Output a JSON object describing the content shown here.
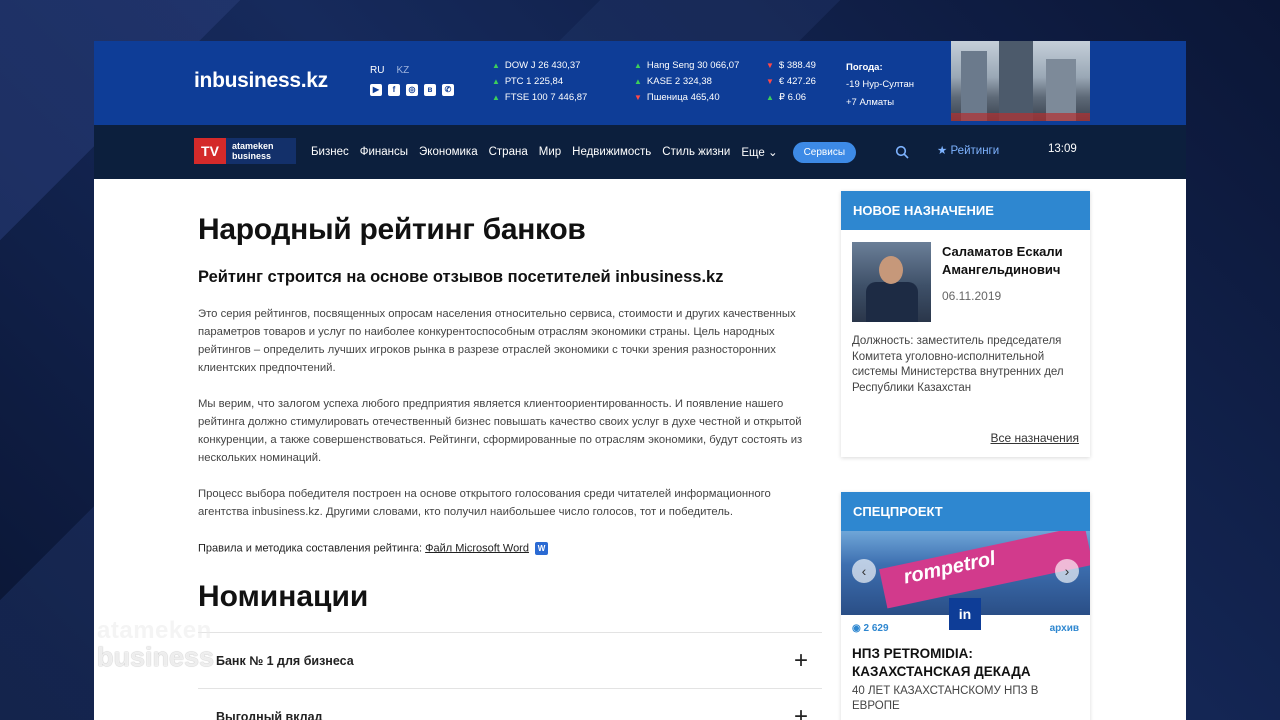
{
  "site": {
    "logo_in": "in",
    "logo_rest": "business.kz"
  },
  "langs": {
    "ru": "RU",
    "kz": "KZ"
  },
  "socials": [
    "youtube-icon",
    "facebook-icon",
    "instagram-icon",
    "vk-icon",
    "whatsapp-icon"
  ],
  "tickers": {
    "col1": [
      {
        "dir": "up",
        "text": "DOW J 26 430,37"
      },
      {
        "dir": "up",
        "text": "РТС 1 225,84"
      },
      {
        "dir": "up",
        "text": "FTSE 100 7 446,87"
      }
    ],
    "col2": [
      {
        "dir": "up",
        "text": "Hang Seng 30 066,07"
      },
      {
        "dir": "up",
        "text": "KASE 2 324,38"
      },
      {
        "dir": "down",
        "text": "Пшеница 465,40"
      }
    ],
    "col3": [
      {
        "dir": "down",
        "text": "$ 388.49"
      },
      {
        "dir": "down",
        "text": "€ 427.26"
      },
      {
        "dir": "up",
        "text": "₽ 6.06"
      }
    ]
  },
  "weather": {
    "title": "Погода:",
    "rows": [
      "-19  Нур-Султан",
      "+7  Алматы"
    ]
  },
  "nav": {
    "tv": "TV",
    "brand_line1": "atameken",
    "brand_line2": "business",
    "items": [
      "Бизнес",
      "Финансы",
      "Экономика",
      "Страна",
      "Мир",
      "Недвижимость",
      "Стиль жизни",
      "Еще"
    ],
    "services": "Сервисы",
    "ratings": "Рейтинги",
    "time": "13:09"
  },
  "main": {
    "title": "Народный рейтинг банков",
    "subtitle": "Рейтинг строится на основе отзывов посетителей inbusiness.kz",
    "paragraphs": [
      "Это серия рейтингов, посвященных опросам населения относительно сервиса, стоимости и других качественных параметров товаров и услуг по наиболее конкурентоспособным отраслям экономики страны. Цель народных рейтингов – определить лучших игроков рынка в разрезе отраслей экономики с точки зрения разносторонних клиентских предпочтений.",
      "Мы верим, что залогом успеха любого предприятия является клиентоориентированность. И появление нашего рейтинга должно стимулировать отечественный бизнес повышать качество своих услуг в духе честной и открытой конкуренции, а также совершенствоваться. Рейтинги, сформированные по отраслям экономики, будут состоять из нескольких номинаций.",
      "Процесс выбора победителя построен на основе открытого голосования среди читателей информационного агентства inbusiness.kz. Другими словами, кто получил наибольшее число голосов, тот и победитель."
    ],
    "rules_label": "Правила и методика составления рейтинга:",
    "rules_link": "Файл Microsoft Word",
    "nominations_title": "Номинации",
    "nominations": [
      "Банк № 1 для бизнеса",
      "Выгодный вклад"
    ]
  },
  "sidebar": {
    "appointment": {
      "header": "НОВОЕ НАЗНАЧЕНИЕ",
      "name": "Саламатов Ескали Амангельдинович",
      "date": "06.11.2019",
      "desc": "Должность: заместитель председателя Комитета уголовно-исполнительной системы Министерства внутренних дел Республики Казахстан",
      "all_link": "Все назначения"
    },
    "special": {
      "header": "СПЕЦПРОЕКТ",
      "banner": "rompetrol",
      "badge": "in",
      "views": "2 629",
      "archive": "архив",
      "title": "НПЗ PETROMIDIA: КАЗАХСТАНСКАЯ ДЕКАДА",
      "sub": "40 ЛЕТ КАЗАХСТАНСКОМУ НПЗ В ЕВРОПЕ"
    }
  },
  "watermark": {
    "line1": "atameken",
    "line2": "business"
  },
  "colors": {
    "topbar": "#0e3d97",
    "navbar": "#0c1f3d",
    "accent": "#2e87d0",
    "services": "#3d8ae6",
    "tv_red": "#d42a2a"
  }
}
